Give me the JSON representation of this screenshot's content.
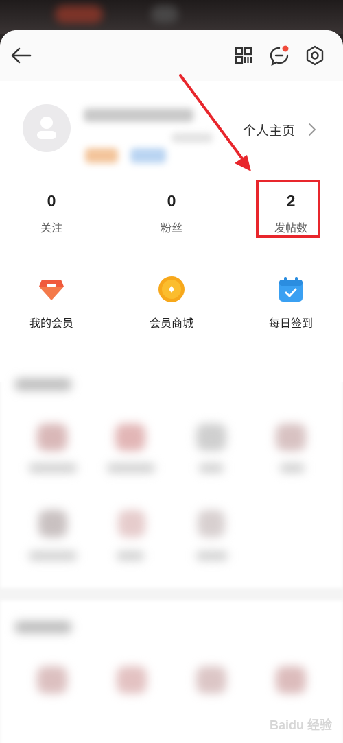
{
  "profile": {
    "home_label": "个人主页"
  },
  "stats": [
    {
      "value": "0",
      "label": "关注"
    },
    {
      "value": "0",
      "label": "粉丝"
    },
    {
      "value": "2",
      "label": "发帖数"
    }
  ],
  "features": [
    {
      "label": "我的会员",
      "icon": "diamond-icon",
      "color": "#f05a3c"
    },
    {
      "label": "会员商城",
      "icon": "coin-icon",
      "color": "#f7a81b"
    },
    {
      "label": "每日签到",
      "icon": "calendar-icon",
      "color": "#3aa0f2"
    }
  ],
  "header": {
    "back_icon": "back-arrow-icon",
    "qr_icon": "qr-code-icon",
    "message_icon": "message-icon",
    "settings_icon": "settings-icon",
    "notification_color": "#f04a3a"
  },
  "annotation": {
    "arrow_color": "#e8262c"
  },
  "watermark": "Baidu 经验"
}
